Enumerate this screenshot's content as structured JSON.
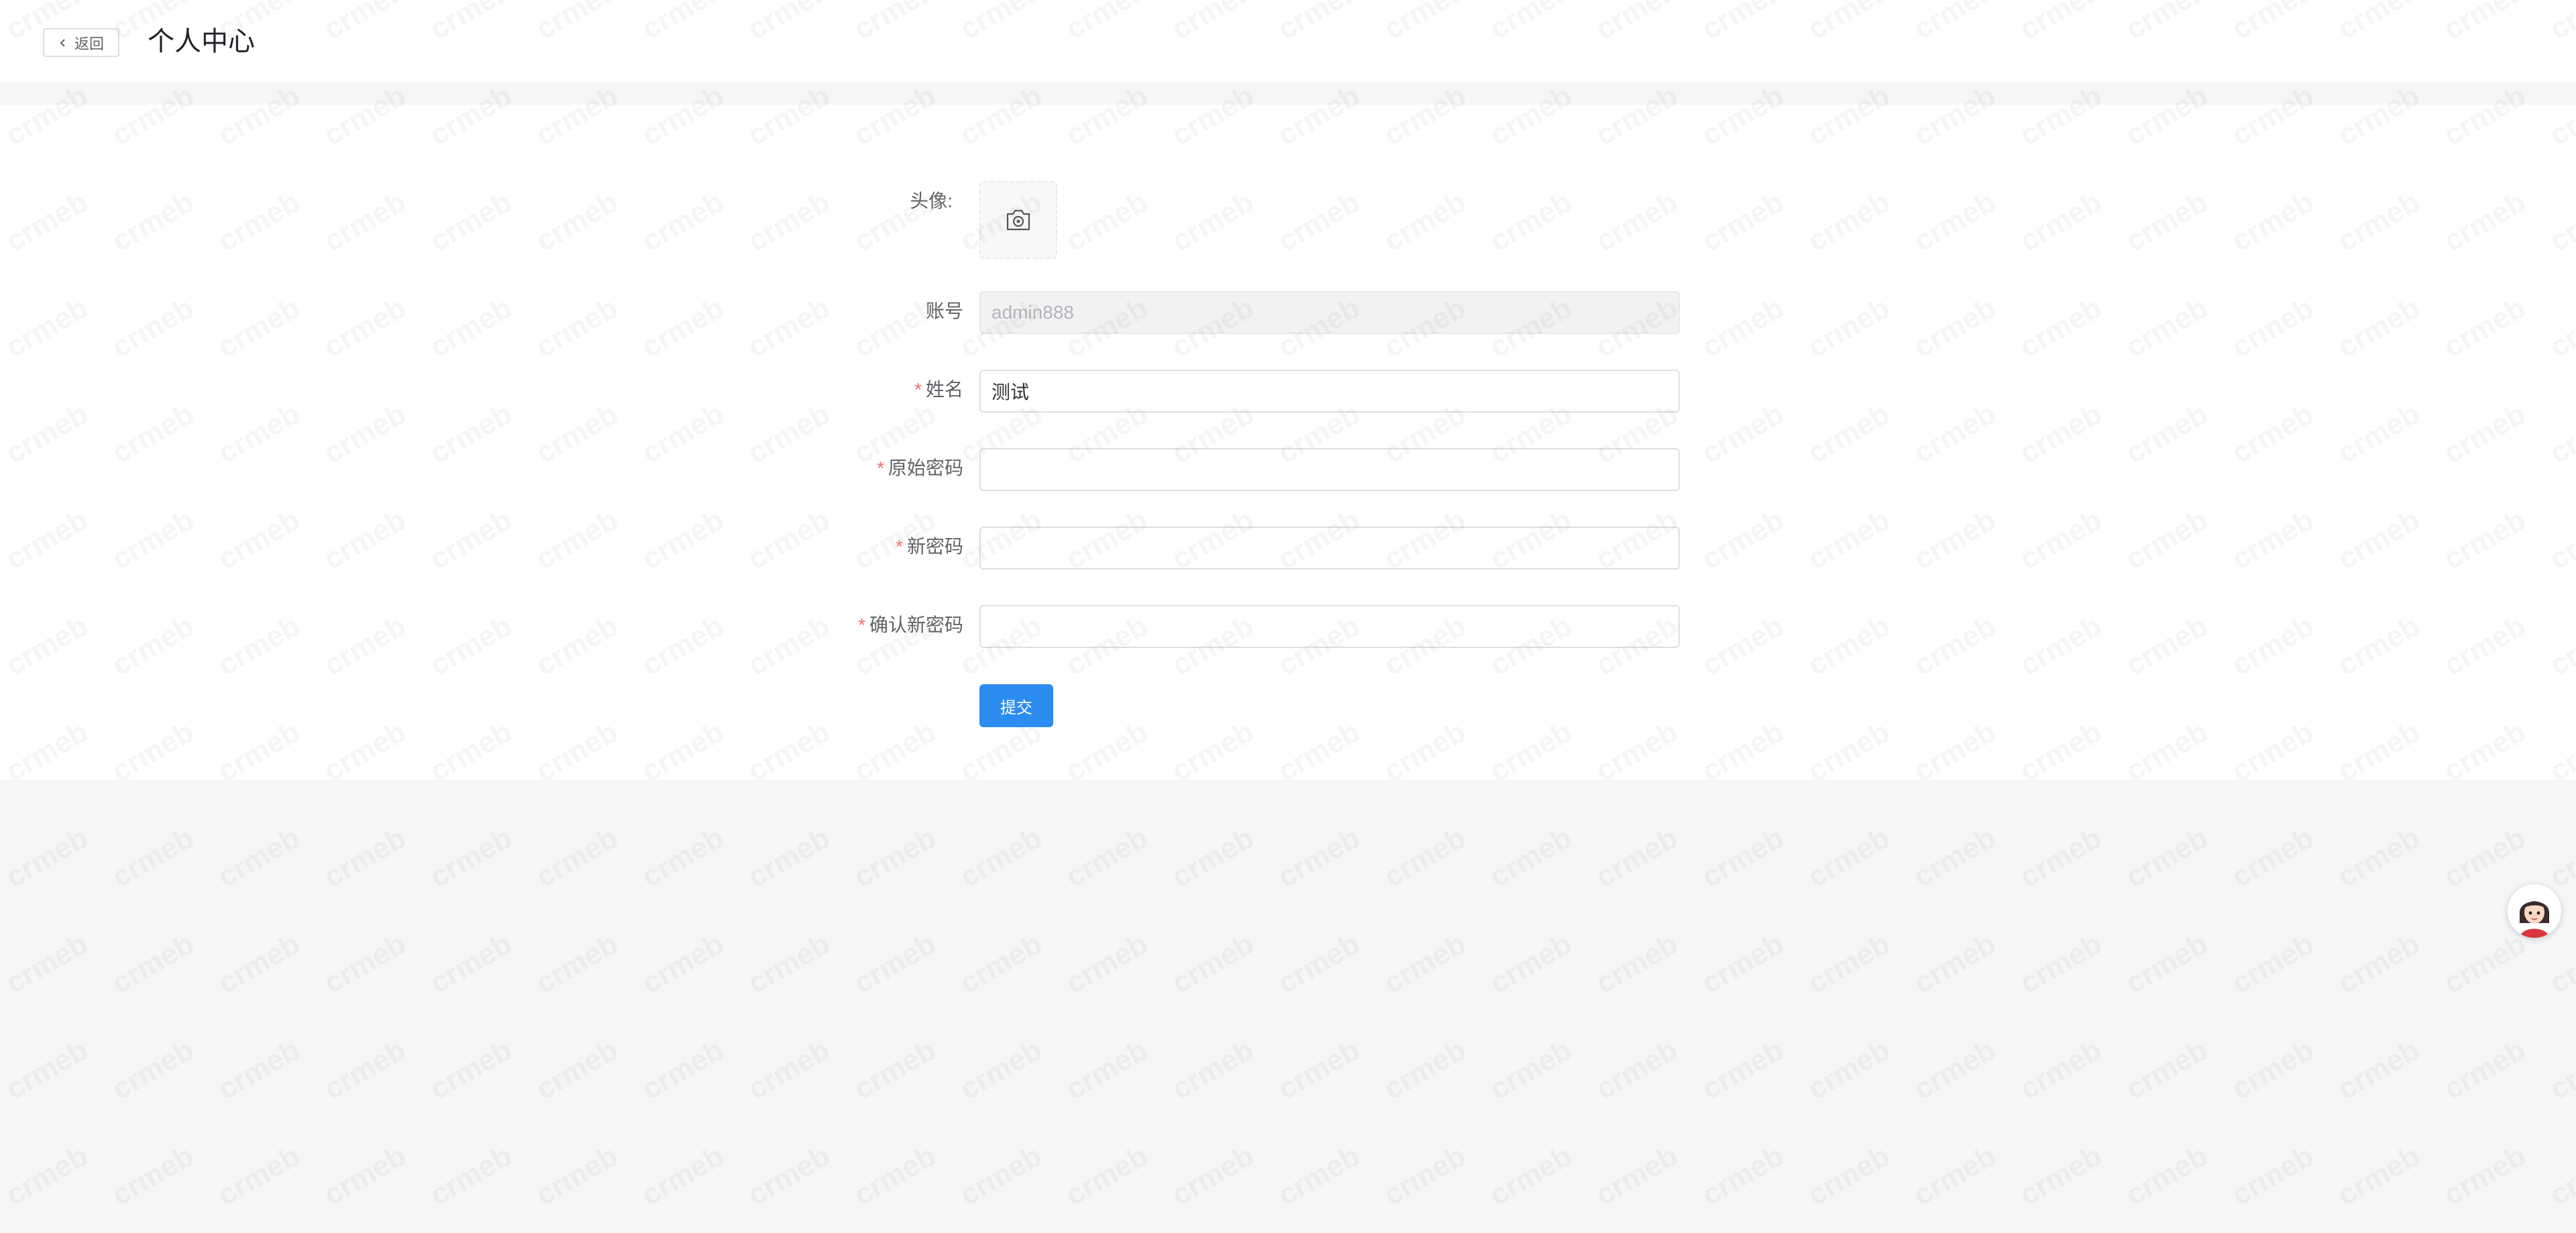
{
  "header": {
    "back_label": "返回",
    "title": "个人中心"
  },
  "form": {
    "avatar_label": "头像:",
    "account_label": "账号",
    "account_value": "admin888",
    "name_label": "姓名",
    "name_value": "测试",
    "old_password_label": "原始密码",
    "new_password_label": "新密码",
    "confirm_password_label": "确认新密码",
    "required_mark": "*",
    "submit_label": "提交"
  },
  "watermark": {
    "text": "crmeb"
  },
  "colors": {
    "primary": "#2d8cf0",
    "required": "#f56c6c",
    "page_bg": "#f5f6f8"
  }
}
